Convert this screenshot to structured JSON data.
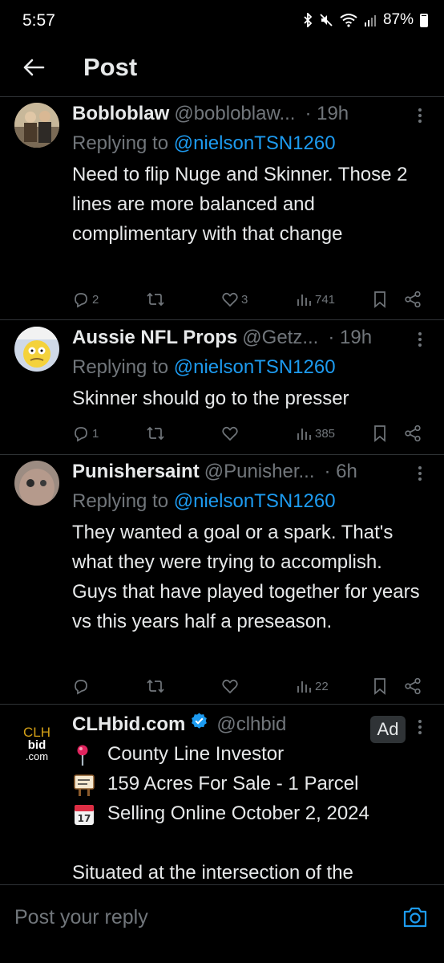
{
  "status_bar": {
    "time": "5:57",
    "battery": "87%"
  },
  "header": {
    "title": "Post"
  },
  "replies": [
    {
      "name": "Bobloblaw",
      "handle": "@bobloblaw...",
      "time": "· 19h",
      "replying_prefix": "Replying to ",
      "replying_to": "@nielsonTSN1260",
      "text": "Need to flip Nuge and Skinner. Those 2 lines are more balanced and complimentary with that change",
      "replies_count": "2",
      "likes_count": "3",
      "views_count": "741"
    },
    {
      "name": "Aussie NFL Props",
      "handle": "@Getz...",
      "time": "· 19h",
      "replying_prefix": "Replying to ",
      "replying_to": "@nielsonTSN1260",
      "text": "Skinner should go to the presser",
      "replies_count": "1",
      "likes_count": "",
      "views_count": "385"
    },
    {
      "name": "Punishersaint",
      "handle": "@Punisher...",
      "time": "· 6h",
      "replying_prefix": "Replying to ",
      "replying_to": "@nielsonTSN1260",
      "text": "They wanted a goal or a spark. That's what they were  trying to accomplish.  Guys that have played together for years vs this years half a preseason.",
      "replies_count": "",
      "likes_count": "",
      "views_count": "22"
    }
  ],
  "ad": {
    "logo_top": "CLH",
    "logo_mid": "bid",
    "logo_bottom": ".com",
    "name": "CLHbid.com",
    "handle": "@clhbid",
    "badge": "Ad",
    "lines": [
      {
        "icon": "pin-icon",
        "text": "County Line Investor"
      },
      {
        "icon": "sign-icon",
        "text": "159 Acres For Sale - 1 Parcel"
      },
      {
        "icon": "calendar-icon",
        "text": "Selling Online October 2, 2024"
      }
    ],
    "calendar_day": "17",
    "body": "Situated at the intersection of the"
  },
  "reply_bar": {
    "placeholder": "Post your reply"
  },
  "colors": {
    "accent": "#1d9bf0",
    "muted": "#71767b",
    "divider": "#2f3336"
  }
}
